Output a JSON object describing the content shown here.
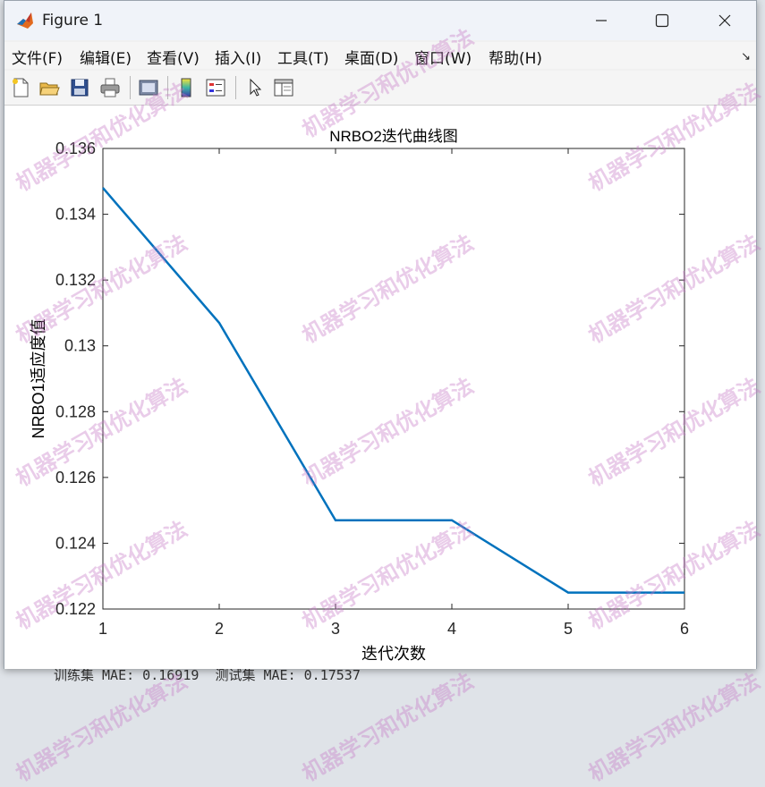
{
  "background": {
    "console_line": "训练集 MAE: 0.16919  测试集 MAE: 0.17537"
  },
  "window": {
    "title": "Figure 1",
    "minimize_icon": "minimize-icon",
    "maximize_icon": "maximize-icon",
    "close_icon": "close-icon"
  },
  "menu": {
    "items": [
      "文件(F)",
      "编辑(E)",
      "查看(V)",
      "插入(I)",
      "工具(T)",
      "桌面(D)",
      "窗口(W)",
      "帮助(H)"
    ]
  },
  "toolbar": {
    "icons": [
      "new-figure-icon",
      "open-file-icon",
      "save-icon",
      "print-icon",
      "print-preview-icon",
      "colorbar-icon",
      "legend-icon",
      "pointer-icon",
      "property-inspector-icon"
    ]
  },
  "watermark": "机器学习和优化算法",
  "colors": {
    "line": "#0072BD",
    "watermark": "#c478c4"
  },
  "chart_data": {
    "type": "line",
    "title": "NRBO2迭代曲线图",
    "xlabel": "迭代次数",
    "ylabel": "NRBO1适应度值",
    "xlim": [
      1,
      6
    ],
    "ylim": [
      0.122,
      0.136
    ],
    "xticks": [
      "1",
      "2",
      "3",
      "4",
      "5",
      "6"
    ],
    "yticks": [
      "0.122",
      "0.124",
      "0.126",
      "0.128",
      "0.13",
      "0.132",
      "0.134",
      "0.136"
    ],
    "x": [
      1,
      2,
      3,
      4,
      5,
      6
    ],
    "y": [
      0.1348,
      0.1307,
      0.1247,
      0.1247,
      0.1225,
      0.1225
    ],
    "grid": false
  }
}
